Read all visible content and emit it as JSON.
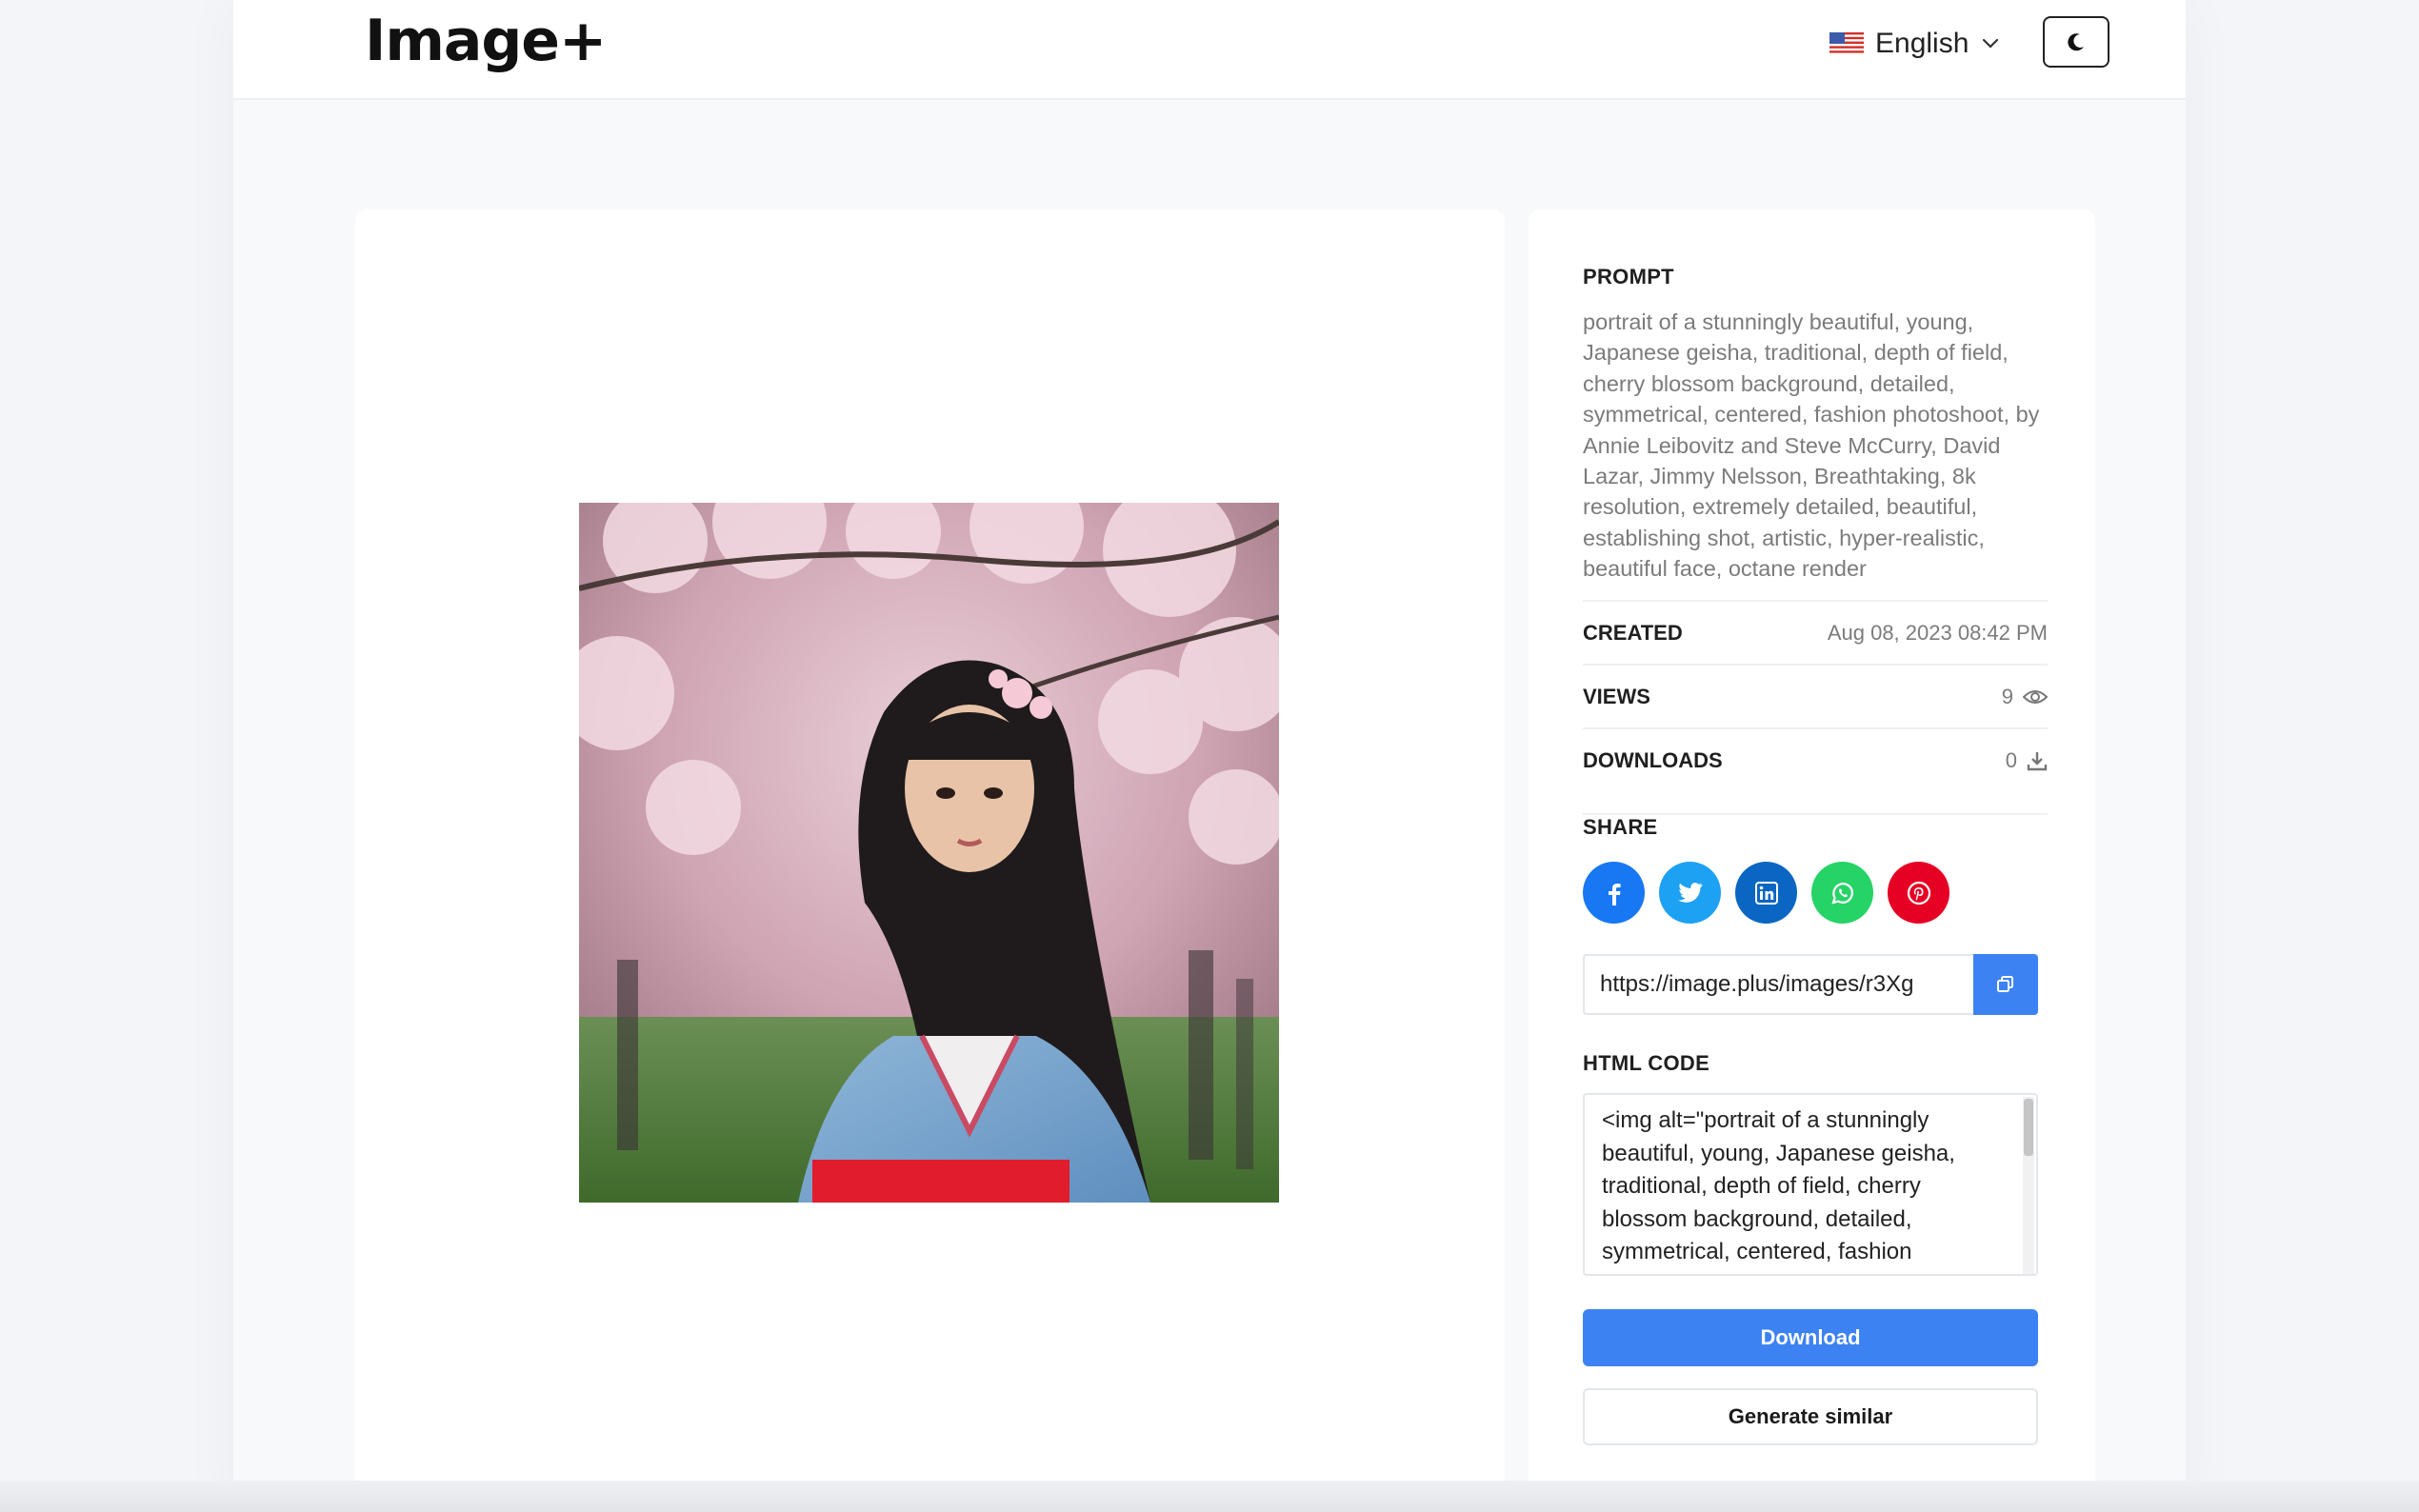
{
  "header": {
    "logo": "Image+",
    "language": "English",
    "language_flag_icon": "us-flag-icon",
    "theme_toggle_icon": "moon-icon"
  },
  "image": {
    "subject": "portrait of a Japanese geisha with cherry blossom background"
  },
  "details": {
    "prompt_label": "PROMPT",
    "prompt": "portrait of a stunningly beautiful, young, Japanese geisha, traditional, depth of field, cherry blossom background, detailed, symmetrical, centered, fashion photoshoot, by Annie Leibovitz and Steve McCurry, David Lazar, Jimmy Nelsson, Breathtaking, 8k resolution, extremely detailed, beautiful, establishing shot, artistic, hyper-realistic, beautiful face, octane render",
    "created_label": "CREATED",
    "created": "Aug 08, 2023 08:42 PM",
    "views_label": "VIEWS",
    "views": "9",
    "downloads_label": "DOWNLOADS",
    "downloads": "0",
    "share_label": "SHARE",
    "share_url": "https://image.plus/images/r3Xg",
    "html_code_label": "HTML CODE",
    "html_code": "<img alt=\"portrait of a stunningly beautiful, young, Japanese geisha, traditional, depth of field, cherry blossom background, detailed, symmetrical, centered, fashion photoshoot, by Annie Leibovitz and Steve McCurry",
    "download_button": "Download",
    "generate_similar_button": "Generate similar"
  },
  "colors": {
    "accent": "#3d82f2",
    "facebook": "#1877f2",
    "twitter": "#1da1f2",
    "linkedin": "#0a66c2",
    "whatsapp": "#25d366",
    "pinterest": "#e60023"
  }
}
